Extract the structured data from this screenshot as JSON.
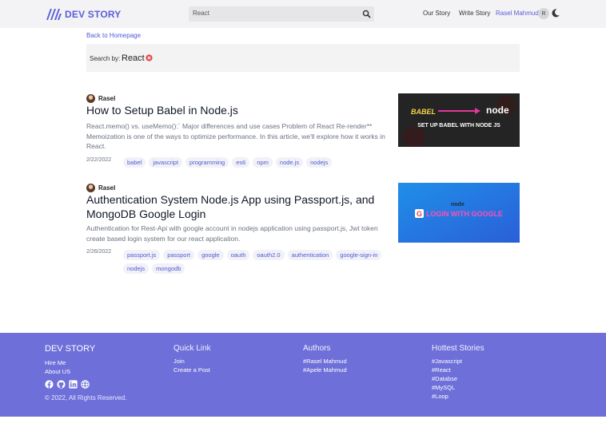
{
  "header": {
    "brand": "DEV STORY",
    "search_value": "React",
    "nav": {
      "our_story": "Our Story",
      "write_story": "Write Story",
      "user_name": "Rasel Mahmud",
      "avatar_initial": "R"
    },
    "icons": {
      "logo": "stripes-logo",
      "search": "search-icon",
      "theme": "moon-icon"
    }
  },
  "back_link": "Back to Homepage",
  "search_by": {
    "label": "Search by:",
    "term": "React",
    "clear_icon": "close-circle-icon"
  },
  "posts": [
    {
      "author": "Rasel",
      "title": "How to Setup Babel in Node.js",
      "excerpt": "React.memo() vs. useMemo():` Major differences and use cases Problem of React Re-render** Memoization is one of the ways to optimize performance. In this article, we'll explore how it works in React.",
      "date": "2/22/2022",
      "tags": [
        "babel",
        "javascript",
        "programming",
        "es6",
        "npm",
        "node.js",
        "nodejs"
      ],
      "thumbnail": {
        "brand": "BABEL",
        "logo": "node",
        "caption": "SET UP BABEL WITH NODE JS"
      }
    },
    {
      "author": "Rasel",
      "title": "Authentication System Node.js App using Passport.js, and MongoDB Google Login",
      "excerpt": "Authentication for Rest-Api with google account in nodejs application using passport.js, Jwt token create based login system for our react application.",
      "date": "2/26/2022",
      "tags": [
        "passport.js",
        "passport",
        "google",
        "oauth",
        "oauth2.0",
        "authentication",
        "google-sign-in",
        "nodejs",
        "mongodb"
      ],
      "thumbnail": {
        "logo": "node",
        "caption": "LOGIN WITH GOOGLE"
      }
    }
  ],
  "footer": {
    "brand": "DEV STORY",
    "brand_links": [
      "Hire Me",
      "About US"
    ],
    "social_icons": [
      "facebook-icon",
      "github-icon",
      "linkedin-icon",
      "globe-icon"
    ],
    "copyright": "© 2022, All Rights Reserved.",
    "quick_link": {
      "heading": "Quick Link",
      "items": [
        "Join",
        "Create a Post"
      ]
    },
    "authors": {
      "heading": "Authors",
      "items": [
        "#Rasel Mahmud",
        "#Apele Mahmud"
      ]
    },
    "hottest": {
      "heading": "Hottest Stories",
      "items": [
        "#Javascript",
        "#React",
        "#Databse",
        "#MySQL",
        "#Loop"
      ]
    }
  },
  "colors": {
    "brand": "#5a5fd6",
    "footer_bg": "#6e6fd9",
    "tag_text": "#4f5bd5"
  }
}
